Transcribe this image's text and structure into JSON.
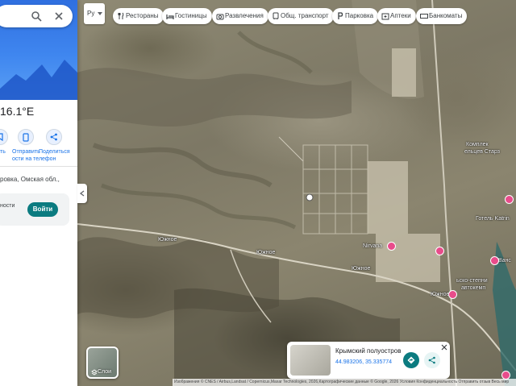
{
  "colors": {
    "accent": "#1a73e8",
    "brand_teal": "#0b7b80",
    "poi_pink": "#e84c8b",
    "panel_blue": "#3f86ef"
  },
  "panel": {
    "coords_title": "16.1°E",
    "actions": [
      {
        "label": "ть",
        "icon": "save-icon"
      },
      {
        "label": "Отправить\nости на телефон",
        "icon": "phone-icon"
      },
      {
        "label": "Поделиться",
        "icon": "share-icon"
      }
    ],
    "address": "ровка, Омская обл.,",
    "signin_text": "ности",
    "signin_button": "Войти"
  },
  "toolbar": {
    "lang": "Ру",
    "chips": [
      {
        "label": "Рестораны",
        "icon": "restaurant-icon"
      },
      {
        "label": "Гостиницы",
        "icon": "hotel-icon"
      },
      {
        "label": "Развлечения",
        "icon": "camera-icon"
      },
      {
        "label": "Общ. транспорт",
        "icon": "transit-icon"
      },
      {
        "label": "Парковка",
        "icon": "parking-icon"
      },
      {
        "label": "Аптеки",
        "icon": "pharmacy-icon"
      },
      {
        "label": "Банкоматы",
        "icon": "atm-icon"
      }
    ]
  },
  "map": {
    "labels": {
      "road1": "Южное",
      "road2": "Южное",
      "road3": "Южное",
      "road4": "Южное",
      "nirvana": "Nirvana",
      "complex": "Комплек",
      "complex2": "ельцев Старз",
      "hotel": "Готель Katrin",
      "bus1": "ьско-степни",
      "bus2": "автокемп",
      "vanso": "Ванс"
    }
  },
  "layers_label": "Слои",
  "info_card": {
    "title": "Крымский полуостров",
    "coords": "44.983206, 35.335774"
  },
  "attribution": "Изображения © CNES / Airbus,Landsat / Copernicus,Maxar Technologies, 2026,Картографические данные © Google, 2026   Условия   Конфиденциальность   Отправить отзыв   Весь мир"
}
